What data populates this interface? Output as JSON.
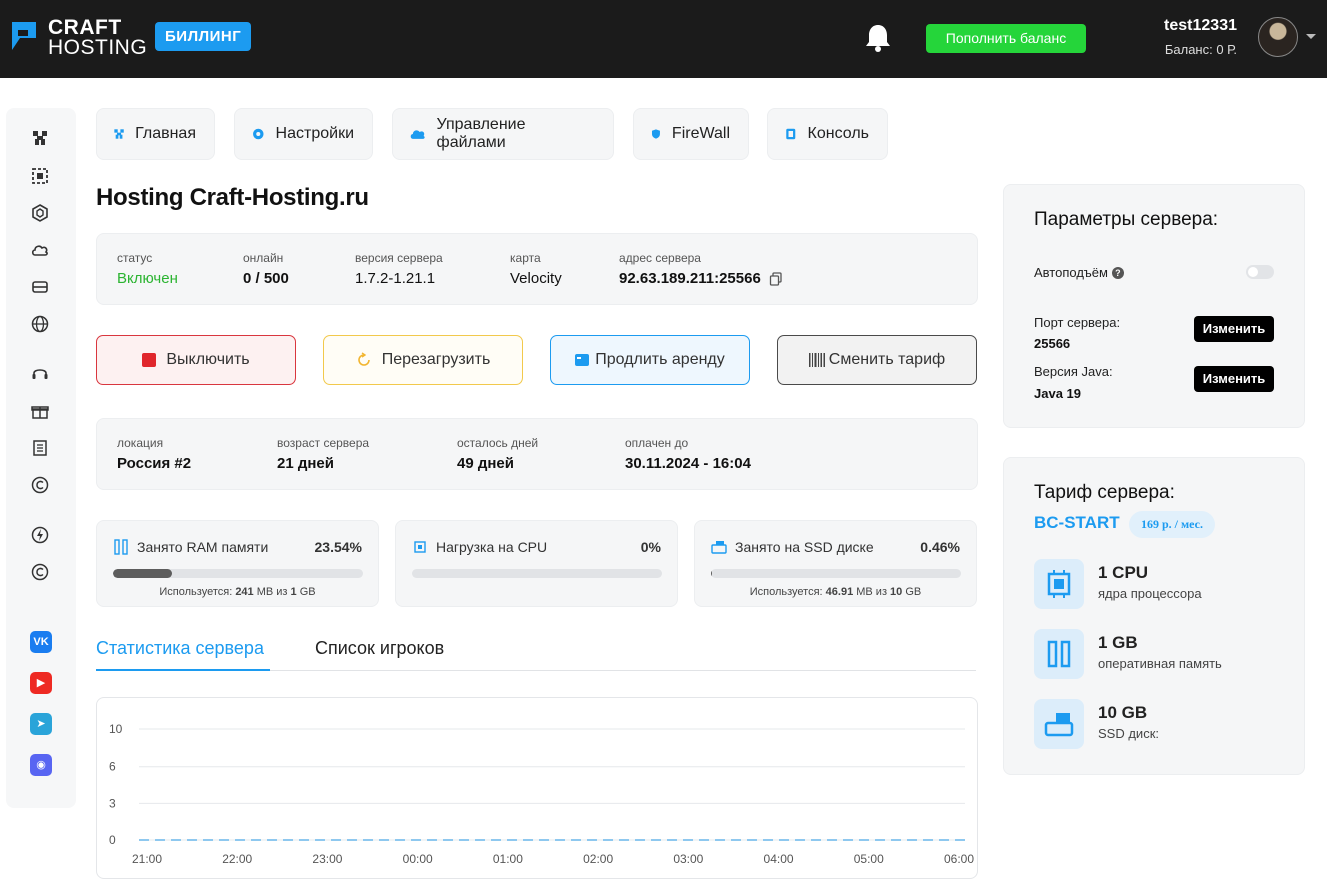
{
  "header": {
    "logo_line1": "CRAFT",
    "logo_line2": "HOSTING",
    "billing_badge": "БИЛЛИНГ",
    "topup_label": "Пополнить баланс",
    "username": "test12331",
    "balance": "Баланс: 0 Р."
  },
  "nav": [
    {
      "label": "Главная",
      "icon": "cube-icon"
    },
    {
      "label": "Настройки",
      "icon": "gear-icon"
    },
    {
      "label": "Управление файлами",
      "icon": "cloud-icon"
    },
    {
      "label": "FireWall",
      "icon": "shield-icon"
    },
    {
      "label": "Консоль",
      "icon": "terminal-icon"
    }
  ],
  "page_title": "Hosting Craft-Hosting.ru",
  "server_info": {
    "status_label": "статус",
    "status_value": "Включен",
    "online_label": "онлайн",
    "online_value": "0 / 500",
    "version_label": "версия сервера",
    "version_value": "1.7.2-1.21.1",
    "map_label": "карта",
    "map_value": "Velocity",
    "address_label": "адрес сервера",
    "address_value": "92.63.189.211:25566"
  },
  "actions": {
    "stop": "Выключить",
    "restart": "Перезагрузить",
    "extend": "Продлить аренду",
    "change_plan": "Сменить тариф"
  },
  "rental_info": {
    "location_label": "локация",
    "location_value": "Россия #2",
    "age_label": "возраст сервера",
    "age_value": "21 дней",
    "days_left_label": "осталось дней",
    "days_left_value": "49 дней",
    "paid_until_label": "оплачен до",
    "paid_until_value": "30.11.2024 - 16:04"
  },
  "resources": {
    "ram": {
      "title": "Занято RAM памяти",
      "percent": "23.54%",
      "fraction": 0.2354,
      "sub_prefix": "Используется: ",
      "used": "241",
      "unit1": " MB из ",
      "total": "1",
      "unit2": " GB"
    },
    "cpu": {
      "title": "Нагрузка на CPU",
      "percent": "0%",
      "fraction": 0
    },
    "ssd": {
      "title": "Занято на SSD диске",
      "percent": "0.46%",
      "fraction": 0.0046,
      "sub_prefix": "Используется: ",
      "used": "46.91",
      "unit1": " MB из ",
      "total": "10",
      "unit2": " GB"
    }
  },
  "tabs": {
    "stats": "Статистика сервера",
    "players": "Список игроков"
  },
  "chart_data": {
    "type": "line",
    "categories": [
      "21:00",
      "22:00",
      "23:00",
      "00:00",
      "01:00",
      "02:00",
      "03:00",
      "04:00",
      "05:00",
      "06:00"
    ],
    "y_ticks": [
      "10",
      "6",
      "3",
      "0"
    ],
    "ylim": [
      0,
      10
    ],
    "series": [
      {
        "values": [
          0,
          0,
          0,
          0,
          0,
          0,
          0,
          0,
          0,
          0
        ],
        "color": "#8ec8ef"
      }
    ]
  },
  "server_params": {
    "title": "Параметры сервера:",
    "autostart_label": "Автоподъём",
    "autostart_on": false,
    "port_label": "Порт сервера:",
    "port_value": "25566",
    "java_label": "Версия Java:",
    "java_value": "Java 19",
    "change_label": "Изменить"
  },
  "plan": {
    "title": "Тариф сервера:",
    "name": "BC-START",
    "price": "169 р. / мес.",
    "specs": [
      {
        "value": "1 CPU",
        "label": "ядра процессора",
        "icon": "cpu-icon"
      },
      {
        "value": "1 GB",
        "label": "оперативная память",
        "icon": "ram-icon"
      },
      {
        "value": "10 GB",
        "label": "SSD диск:",
        "icon": "ssd-icon"
      }
    ]
  },
  "colors": {
    "accent": "#1c9bf0",
    "topup": "#25d53a",
    "status_on": "#2bb431",
    "stop_border": "#d9363e",
    "restart_border": "#f2c94c",
    "extend_border": "#1c9bf0"
  }
}
